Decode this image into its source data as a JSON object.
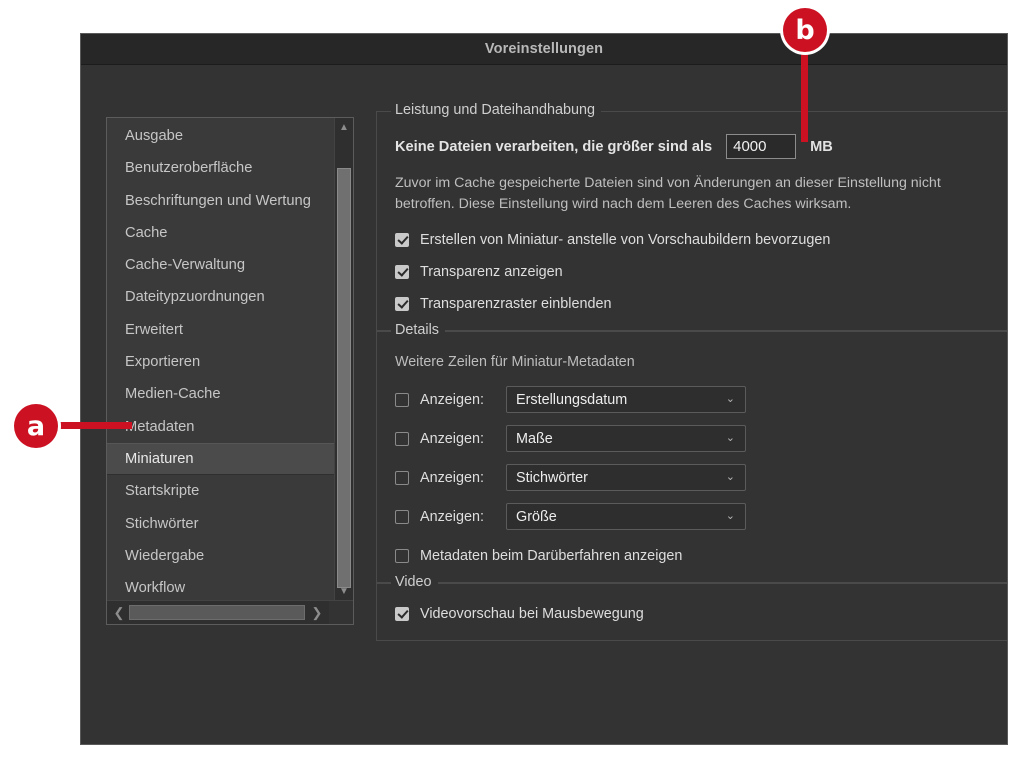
{
  "window": {
    "title": "Voreinstellungen"
  },
  "sidebar": {
    "items": [
      {
        "label": "Ausgabe",
        "selected": false
      },
      {
        "label": "Benutzeroberfläche",
        "selected": false
      },
      {
        "label": "Beschriftungen und Wertung",
        "selected": false
      },
      {
        "label": "Cache",
        "selected": false
      },
      {
        "label": "Cache-Verwaltung",
        "selected": false
      },
      {
        "label": "Dateitypzuordnungen",
        "selected": false
      },
      {
        "label": "Erweitert",
        "selected": false
      },
      {
        "label": "Exportieren",
        "selected": false
      },
      {
        "label": "Medien-Cache",
        "selected": false
      },
      {
        "label": "Metadaten",
        "selected": false
      },
      {
        "label": "Miniaturen",
        "selected": true
      },
      {
        "label": "Startskripte",
        "selected": false
      },
      {
        "label": "Stichwörter",
        "selected": false
      },
      {
        "label": "Wiedergabe",
        "selected": false
      },
      {
        "label": "Workflow",
        "selected": false
      }
    ],
    "scroll_up_icon": "chevron-up-icon",
    "scroll_down_icon": "chevron-down-icon",
    "scroll_left_icon": "chevron-left-icon",
    "scroll_right_icon": "chevron-right-icon"
  },
  "performance": {
    "group_title": "Leistung und Dateihandhabung",
    "max_size_label": "Keine Dateien verarbeiten, die größer sind als",
    "max_size_value": "4000",
    "max_size_unit": "MB",
    "description": "Zuvor im Cache gespeicherte Dateien sind von Änderungen an dieser Einstellung nicht betroffen. Diese Einstellung wird nach dem Leeren des Caches wirksam.",
    "checkboxes": [
      {
        "label": "Erstellen von Miniatur- anstelle von Vorschaubildern bevorzugen",
        "checked": true
      },
      {
        "label": "Transparenz anzeigen",
        "checked": true
      },
      {
        "label": "Transparenzraster einblenden",
        "checked": true
      }
    ]
  },
  "details": {
    "group_title": "Details",
    "subtext": "Weitere Zeilen für Miniatur-Metadaten",
    "rows": [
      {
        "label": "Anzeigen:",
        "checked": false,
        "value": "Erstellungsdatum"
      },
      {
        "label": "Anzeigen:",
        "checked": false,
        "value": "Maße"
      },
      {
        "label": "Anzeigen:",
        "checked": false,
        "value": "Stichwörter"
      },
      {
        "label": "Anzeigen:",
        "checked": false,
        "value": "Größe"
      }
    ],
    "hover_checkbox": {
      "label": "Metadaten beim Darüberfahren anzeigen",
      "checked": false
    },
    "dropdown_icon": "chevron-down-icon"
  },
  "video": {
    "group_title": "Video",
    "checkboxes": [
      {
        "label": "Videovorschau bei Mausbewegung",
        "checked": true
      }
    ]
  },
  "callouts": [
    {
      "id": "a",
      "label": "a"
    },
    {
      "id": "b",
      "label": "b"
    }
  ],
  "colors": {
    "accent": "#cc1122",
    "window_bg": "#333333",
    "titlebar_bg": "#272727",
    "list_bg": "#3a3a3a",
    "selected_bg": "#4b4b4b"
  }
}
